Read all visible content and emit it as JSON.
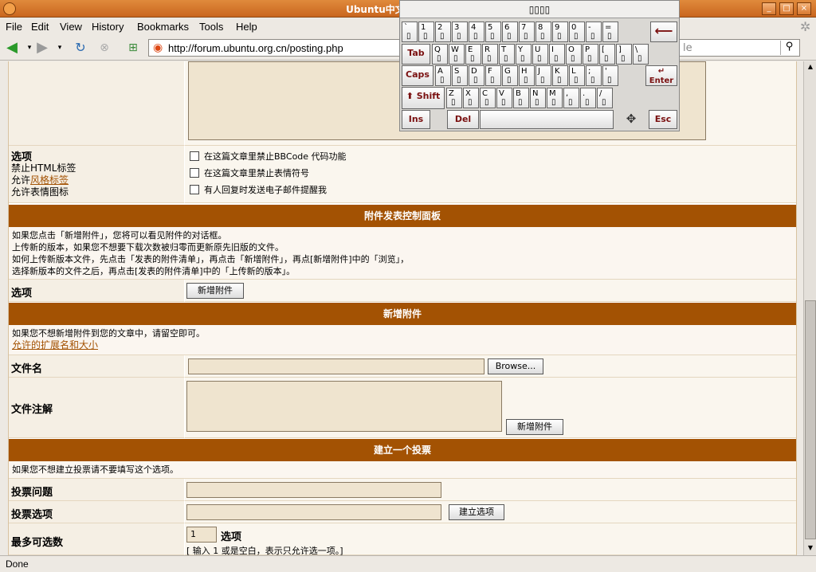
{
  "window": {
    "title": "Ubuntu中文 论坛 :: 发表新",
    "controls": [
      "_",
      "□",
      "×"
    ]
  },
  "menu": [
    "File",
    "Edit",
    "View",
    "History",
    "Bookmarks",
    "Tools",
    "Help"
  ],
  "nav": {
    "url": "http://forum.ubuntu.org.cn/posting.php",
    "search_hint": "le",
    "icons": [
      "back-icon",
      "forward-icon",
      "reload-icon",
      "stop-icon",
      "new-tab-icon",
      "ubuntu-icon",
      "search-icon"
    ]
  },
  "options": {
    "label": "选项",
    "html": "禁止HTML标签",
    "bbcode_prefix": "允许",
    "bbcode_link": "风格标签",
    "smilies": "允许表情图标",
    "checks": [
      "在这篇文章里禁止BBCode 代码功能",
      "在这篇文章里禁止表情符号",
      "有人回复时发送电子邮件提醒我"
    ]
  },
  "attach_panel": {
    "header": "附件发表控制面板",
    "notes": [
      "如果您点击「新增附件」，您将可以看见附件的对话框。",
      "上传新的版本，如果您不想要下载次数被归零而更新原先旧版的文件。",
      "如何上传新版本文件，先点击「发表的附件清单」，再点击「新增附件」，再点[新增附件]中的「浏览」，",
      "选择新版本的文件之后，再点击[发表的附件清单]中的「上传新的版本」。"
    ],
    "option_label": "选项",
    "add_button": "新增附件"
  },
  "new_attach": {
    "header": "新增附件",
    "note": "如果您不想新增附件到您的文章中，请留空即可。",
    "ext_link": "允许的扩展名和大小",
    "file_label": "文件名",
    "browse": "Browse...",
    "comment_label": "文件注解",
    "add_button": "新增附件"
  },
  "poll": {
    "header": "建立一个投票",
    "note": "如果您不想建立投票请不要填写这个选项。",
    "question_label": "投票问题",
    "option_label": "投票选项",
    "add_option": "建立选项",
    "max_label": "最多可选数",
    "max_value": "1",
    "max_unit": "选项",
    "max_hint": "[ 输入 1 或是空白，表示只允许选一项。]"
  },
  "status": "Done",
  "keyboard": {
    "title": "▯▯▯▯",
    "row1": [
      [
        "`",
        "▯"
      ],
      [
        "1",
        "▯"
      ],
      [
        "2",
        "▯"
      ],
      [
        "3",
        "▯"
      ],
      [
        "4",
        "▯"
      ],
      [
        "5",
        "▯"
      ],
      [
        "6",
        "▯"
      ],
      [
        "7",
        "▯"
      ],
      [
        "8",
        "▯"
      ],
      [
        "9",
        "▯"
      ],
      [
        "0",
        "▯"
      ],
      [
        "-",
        "▯"
      ],
      [
        "=",
        "▯"
      ]
    ],
    "row2": [
      [
        "Q",
        "▯"
      ],
      [
        "W",
        "▯"
      ],
      [
        "E",
        "▯"
      ],
      [
        "R",
        "▯"
      ],
      [
        "T",
        "▯"
      ],
      [
        "Y",
        "▯"
      ],
      [
        "U",
        "▯"
      ],
      [
        "I",
        "▯"
      ],
      [
        "O",
        "▯"
      ],
      [
        "P",
        "▯"
      ],
      [
        "[",
        "▯"
      ],
      [
        "]",
        "▯"
      ],
      [
        "\\",
        "▯"
      ]
    ],
    "row3": [
      [
        "A",
        "▯"
      ],
      [
        "S",
        "▯"
      ],
      [
        "D",
        "▯"
      ],
      [
        "F",
        "▯"
      ],
      [
        "G",
        "▯"
      ],
      [
        "H",
        "▯"
      ],
      [
        "J",
        "▯"
      ],
      [
        "K",
        "▯"
      ],
      [
        "L",
        "▯"
      ],
      [
        ";",
        "▯"
      ],
      [
        "'",
        "▯"
      ]
    ],
    "row4": [
      [
        "Z",
        "▯"
      ],
      [
        "X",
        "▯"
      ],
      [
        "C",
        "▯"
      ],
      [
        "V",
        "▯"
      ],
      [
        "B",
        "▯"
      ],
      [
        "N",
        "▯"
      ],
      [
        "M",
        "▯"
      ],
      [
        ",",
        "▯"
      ],
      [
        ".",
        "▯"
      ],
      [
        "/",
        "▯"
      ]
    ],
    "backspace": "⟵",
    "tab": "Tab",
    "caps": "Caps",
    "enter": "Enter",
    "shift": "Shift",
    "ins": "Ins",
    "del": "Del",
    "esc": "Esc",
    "move": "✥"
  }
}
